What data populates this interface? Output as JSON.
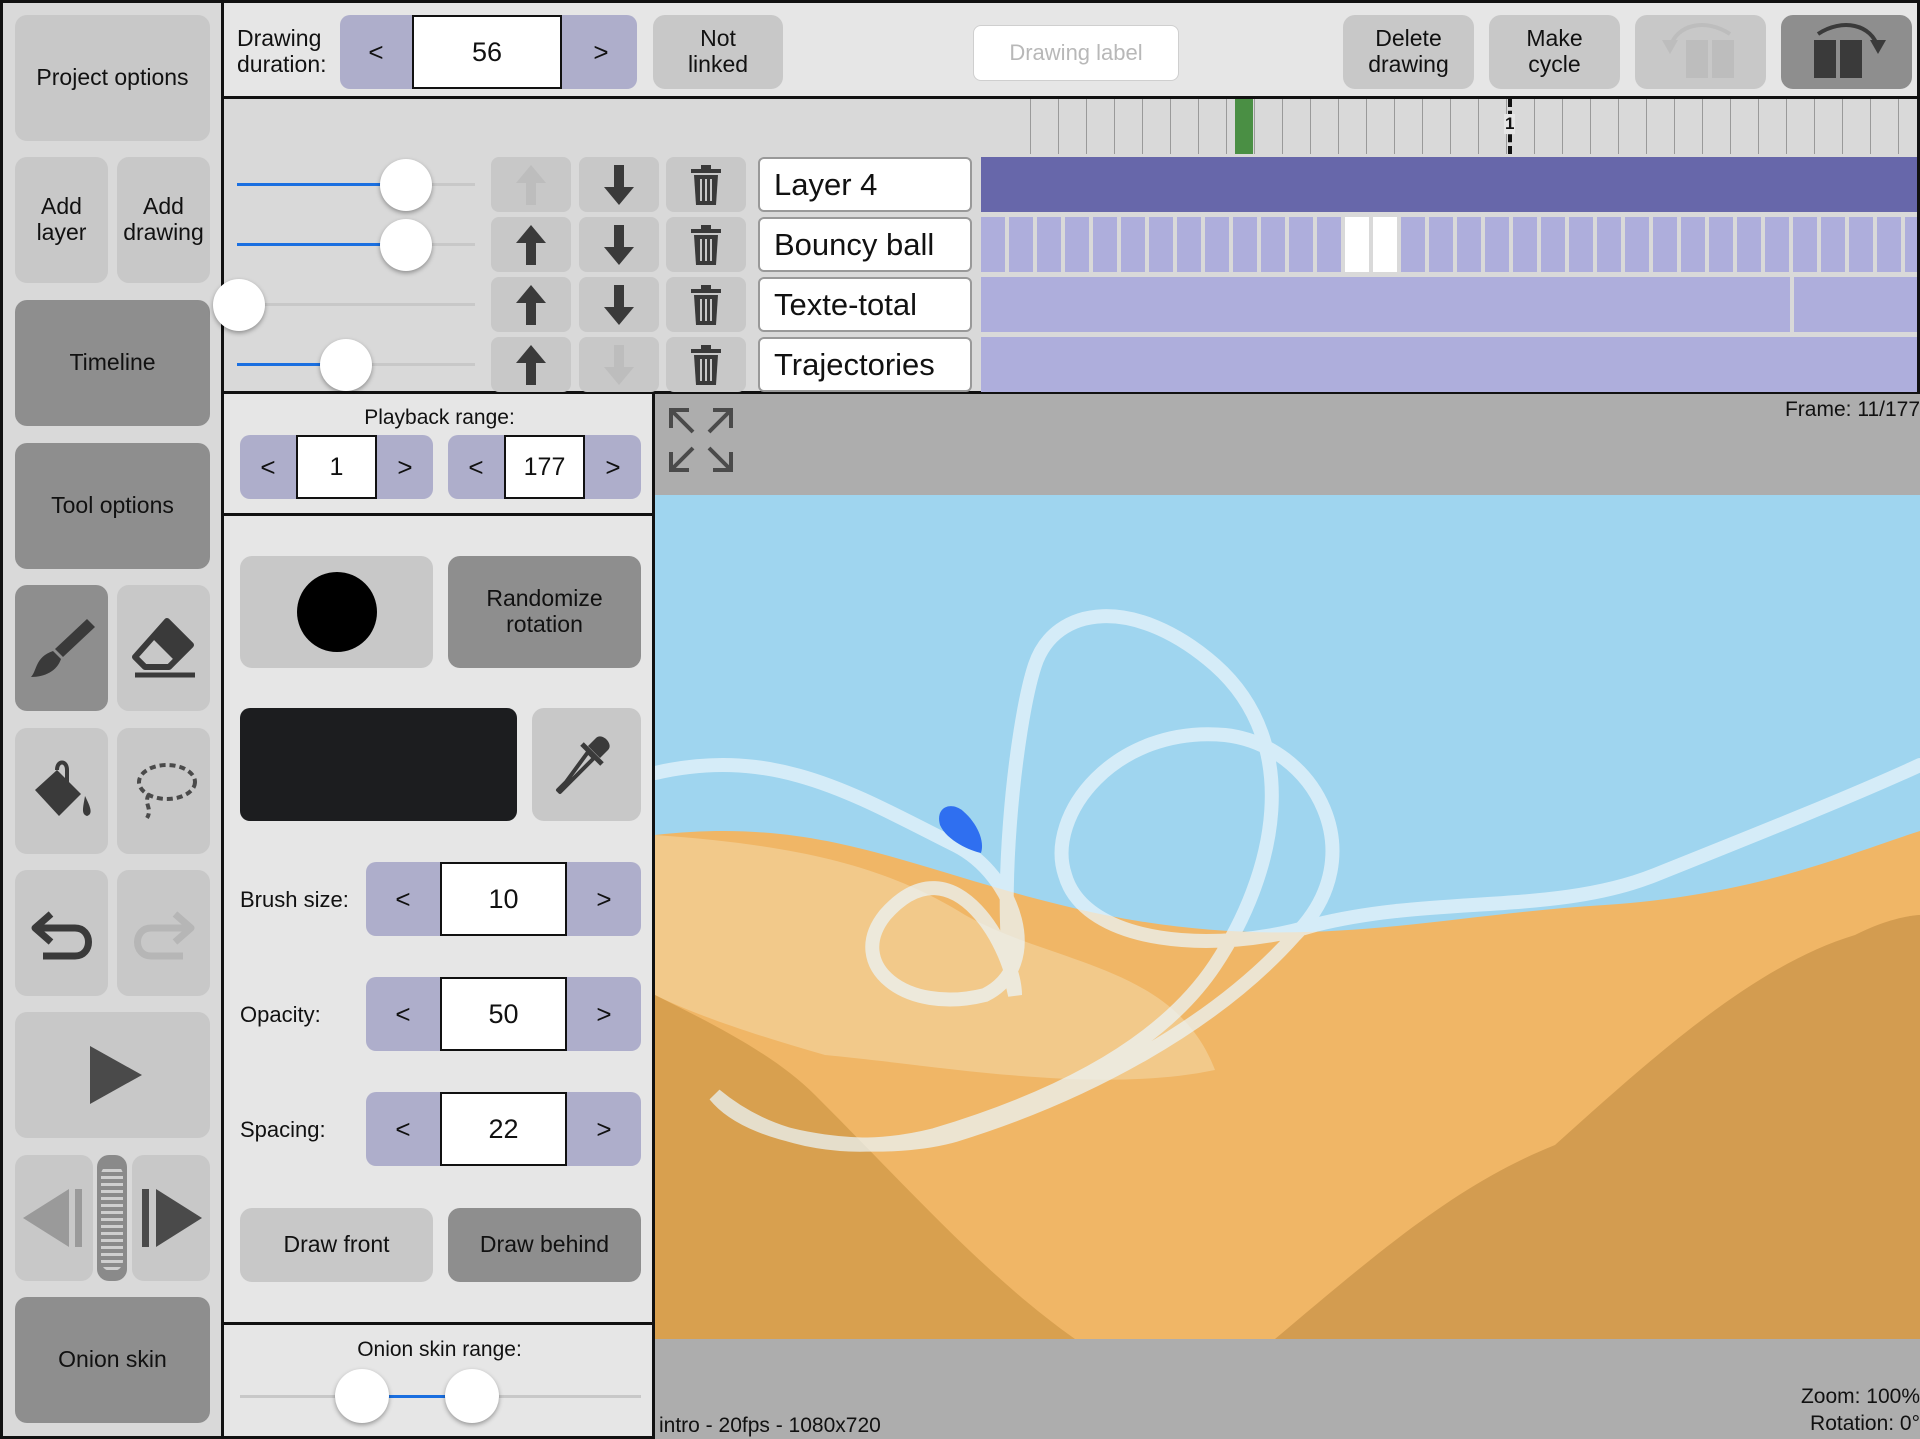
{
  "left_panel": {
    "project_options": "Project options",
    "add_layer": "Add\nlayer",
    "add_drawing": "Add\ndrawing",
    "timeline": "Timeline",
    "tool_options": "Tool options",
    "onion_skin": "Onion skin"
  },
  "top_bar": {
    "drawing_duration_label": "Drawing\nduration:",
    "drawing_duration_value": "56",
    "prev": "<",
    "next": ">",
    "not_linked": "Not\nlinked",
    "drawing_label_placeholder": "Drawing label",
    "delete_drawing": "Delete\ndrawing",
    "make_cycle": "Make\ncycle"
  },
  "timeline": {
    "marker_label": "1",
    "layers": [
      {
        "name": "Layer 4",
        "opacity": 0.7,
        "up_enabled": false,
        "down_enabled": true
      },
      {
        "name": "Bouncy ball",
        "opacity": 0.7,
        "up_enabled": true,
        "down_enabled": true
      },
      {
        "name": "Texte-total",
        "opacity": 0.0,
        "up_enabled": true,
        "down_enabled": true
      },
      {
        "name": "Trajectories",
        "opacity": 0.45,
        "up_enabled": true,
        "down_enabled": false
      }
    ]
  },
  "tool_panel": {
    "playback_range_label": "Playback range:",
    "playback_start": "1",
    "playback_end": "177",
    "randomize_rotation": "Randomize\nrotation",
    "brush_size_label": "Brush size:",
    "brush_size": "10",
    "opacity_label": "Opacity:",
    "opacity": "50",
    "spacing_label": "Spacing:",
    "spacing": "22",
    "draw_front": "Draw front",
    "draw_behind": "Draw behind",
    "onion_skin_range_label": "Onion skin range:",
    "brush_color": "#1c1d1f"
  },
  "canvas": {
    "frame_label": "Frame: 11/177",
    "project_info": "intro - 20fps - 1080x720",
    "zoom": "Zoom: 100%",
    "rotation": "Rotation: 0°",
    "sky_color": "#9fd5ef",
    "sand_color": "#f0b666"
  },
  "colors": {
    "accent_blue": "#1a6fe0",
    "layer_bar_dark": "#6767aa",
    "layer_bar_light": "#aeaedc",
    "current_frame_marker": "#4a8f44"
  }
}
